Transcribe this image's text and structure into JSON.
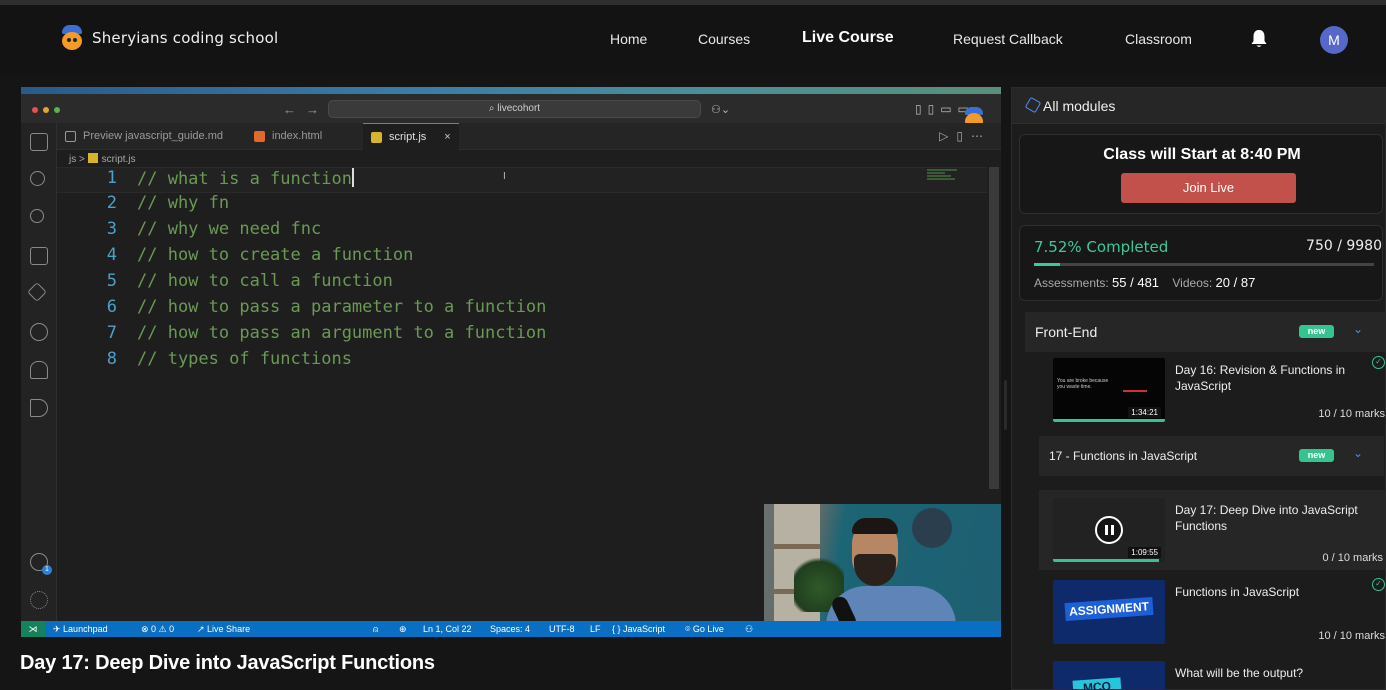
{
  "site": {
    "name": "Sheryians coding school"
  },
  "nav": {
    "home": "Home",
    "courses": "Courses",
    "live_course": "Live Course",
    "request_callback": "Request Callback",
    "classroom": "Classroom",
    "avatar_initial": "M"
  },
  "video": {
    "title": "Day 17: Deep Dive into JavaScript Functions",
    "editor": {
      "search_text": "livecohort",
      "tabs": [
        {
          "label": "Preview javascript_guide.md"
        },
        {
          "label": "index.html"
        },
        {
          "label": "script.js",
          "close": "×"
        }
      ],
      "breadcrumb": {
        "folder": "js",
        "sep": ">",
        "file": "script.js"
      },
      "lines": [
        {
          "n": "1",
          "text": "// what is a function"
        },
        {
          "n": "2",
          "text": "// why fn"
        },
        {
          "n": "3",
          "text": "// why we need fnc"
        },
        {
          "n": "4",
          "text": "// how to create a function"
        },
        {
          "n": "5",
          "text": "// how to call a function"
        },
        {
          "n": "6",
          "text": "// how to pass a parameter to a function"
        },
        {
          "n": "7",
          "text": "// how to pass an argument to a function"
        },
        {
          "n": "8",
          "text": "// types of functions"
        }
      ],
      "status": {
        "launchpad": "Launchpad",
        "problems": "⊗ 0 ⚠ 0",
        "live_share": "Live Share",
        "position": "Ln 1, Col 22",
        "spaces": "Spaces: 4",
        "encoding": "UTF-8",
        "eol": "LF",
        "language": "{ } JavaScript",
        "go_live": "Go Live"
      },
      "account_badge": "1"
    }
  },
  "panel": {
    "all_modules": "All modules",
    "class_start": "Class will Start at 8:40 PM",
    "join_live": "Join Live",
    "progress": {
      "percent_text": "7.52% Completed",
      "percent_value": 7.52,
      "marks": "750 / 9980",
      "assessments_label": "Assessments:",
      "assessments": "55 / 481",
      "videos_label": "Videos:",
      "videos": "20 / 87"
    },
    "sections": [
      {
        "title": "Front-End",
        "badge": "new"
      },
      {
        "title": "17 - Functions in JavaScript",
        "badge": "new"
      }
    ],
    "lessons": [
      {
        "title": "Day 16: Revision & Functions in JavaScript",
        "duration": "1:34:21",
        "marks": "10 / 10 marks",
        "thumb_text": "You are broke because you waste time.",
        "progress": 1.0
      },
      {
        "title": "Day 17: Deep Dive into JavaScript Functions",
        "duration": "1:09:55",
        "marks": "0 / 10 marks",
        "progress": 0.95
      },
      {
        "title": "Functions in JavaScript",
        "marks": "10 / 10 marks",
        "thumb_text": "ASSIGNMENT"
      },
      {
        "title": "What will be the output?",
        "thumb_text": "MCQ"
      }
    ]
  },
  "colors": {
    "accent_green": "#35c390",
    "join_red": "#c2504b",
    "vscode_blue": "#0a6fc2",
    "link_blue": "#4a8ff0"
  }
}
